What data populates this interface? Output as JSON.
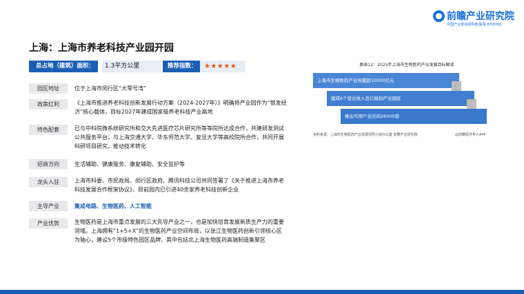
{
  "logo": {
    "name": "前瞻产业研究院",
    "sub": "中国产业咨询领导者(股票:839599)"
  },
  "title": "上海：上海市养老科技产业园开园",
  "header": {
    "area_label": "总占地（建筑）面积：",
    "area_value": "1.3平方公里",
    "rating_label": "推荐指数：",
    "rating_stars": "★★★★★",
    "rating_value": 5
  },
  "rows": [
    {
      "label": "园区地址",
      "text": "位于上海市闵行区“大零号湾”"
    },
    {
      "label": "政策红利",
      "text": "《上海市推进养老科技创新发展行动方案（2024-2027年）》明确将产业园作为“银发经济”核心载体，目标2027年建成国家级养老科技产业高地"
    },
    {
      "label": "特色配套",
      "text": "已与中科院微系统研究所和交大先进医疗芯片研究所等等院所达成合作，共建研发测试公共服务平台；与上海交通大学、华东师范大学、复旦大学等高校院所合作，共同开展科研项目研究，推动技术转化"
    },
    {
      "label": "招商方向",
      "text": "生活辅助、健康服务、康复辅助、安全监护等"
    },
    {
      "label": "龙头入驻",
      "text": "上海市科委、市民政局、闵行区政府、腾讯科技公司共同签署了《关于推进上海市养老科技发展合作框架协议》，目前园内已引进40余家养老科技创新企业"
    },
    {
      "label": "主导产业",
      "text": "集成电路、生物医药、人工智能"
    },
    {
      "label": "产业优势",
      "text": "生物医药是上海市重点发展的三大先导产业之一，也是加快培育发展新质生产力的重要领域。上海拥有“1+5+X”的生物医药产业空间布局，以张江生物医药创新引领核心区为轴心，建设5个市级特色园区品牌，其中包括北上海生物医药高端制造集聚区"
    }
  ],
  "figure": {
    "title": "图表12：2025年上海市生物医药产业发展目标解读",
    "bars": [
      "上海市生物医药产业规模超10000亿元",
      "建成6个营业收入百亿级别产业园区",
      "推出可用产业空间26000亩"
    ],
    "source": "资料来源：上海市生物医药产业发展领导小组办公室 前瞻产业研究院",
    "watermark": "@前瞻经济学人APP"
  },
  "colors": {
    "accent": "#1a5fb4",
    "star": "#e8541e",
    "label_bg": "#e9e9ec"
  }
}
